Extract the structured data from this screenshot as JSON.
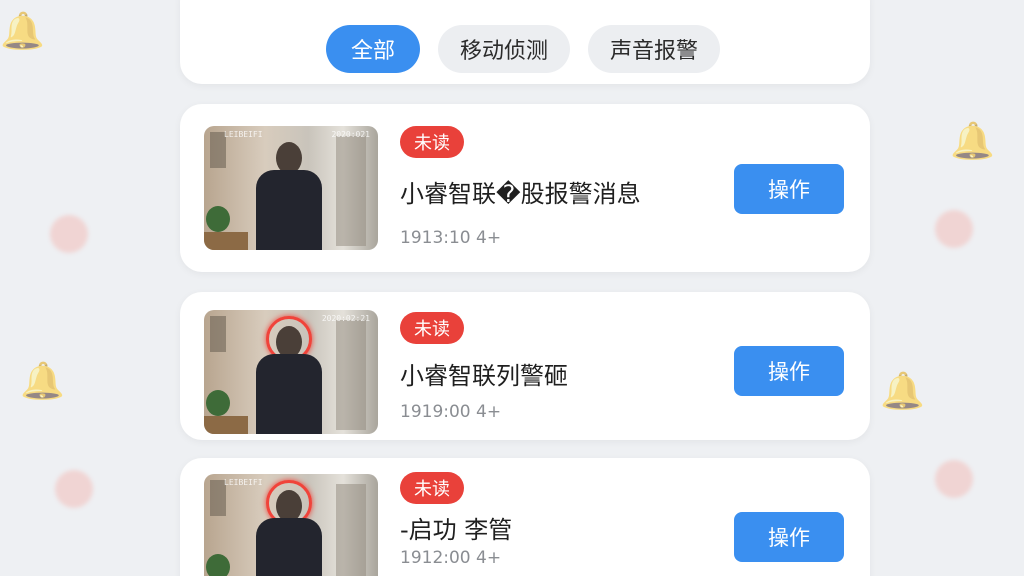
{
  "filters": [
    {
      "label": "全部",
      "active": true
    },
    {
      "label": "移动侦测",
      "active": false
    },
    {
      "label": "声音报警",
      "active": false
    }
  ],
  "messages": [
    {
      "badge": "未读",
      "title": "小睿智联�股报警消息",
      "time": "1913:10 4+",
      "action": "操作",
      "thumb_stamp_left": "LEIBEIFI",
      "thumb_stamp_right": "2020:021",
      "highlight_ring": false
    },
    {
      "badge": "未读",
      "title": "小睿智联列警砸",
      "time": "1919:00 4+",
      "action": "操作",
      "thumb_stamp_left": "",
      "thumb_stamp_right": "2020:02:21",
      "highlight_ring": true
    },
    {
      "badge": "未读",
      "title": "-启功 李管",
      "time": "1912:00 4+",
      "action": "操作",
      "thumb_stamp_left": "LEIBEIFI",
      "thumb_stamp_right": "",
      "highlight_ring": true
    }
  ],
  "colors": {
    "accent": "#3a8ff0",
    "unread": "#e9413a"
  }
}
